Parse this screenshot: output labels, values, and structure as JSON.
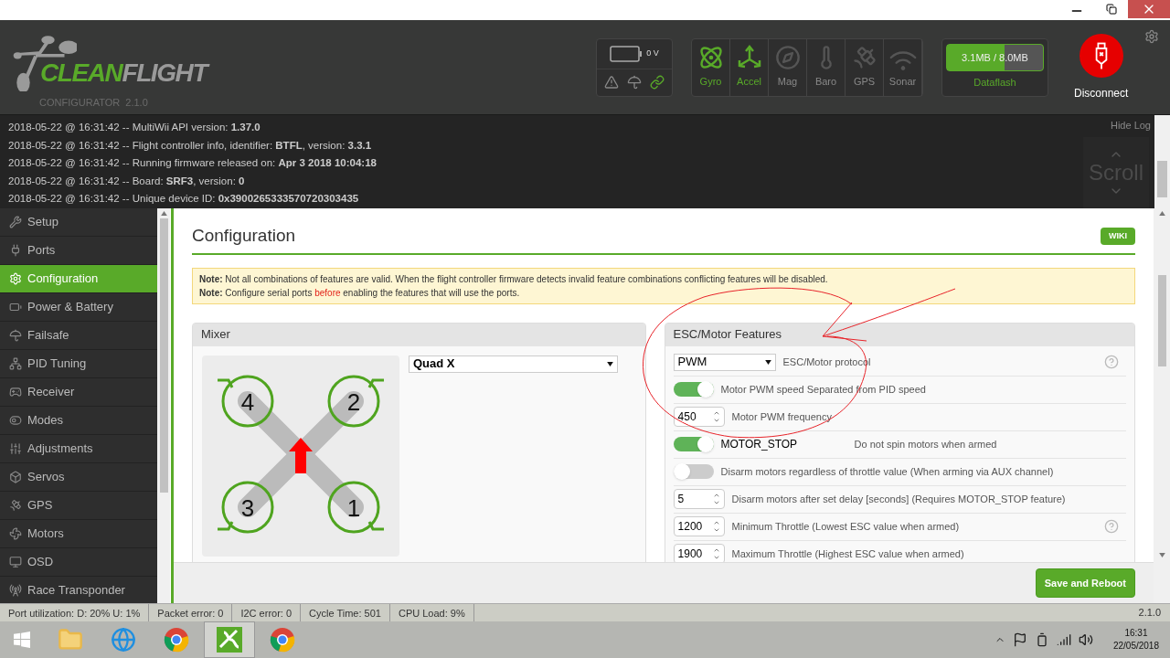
{
  "header": {
    "logo_primary": "CLEAN",
    "logo_secondary": "FLIGHT",
    "subtitle": "CONFIGURATOR  2.1.0",
    "battery": {
      "voltage": "0 V"
    },
    "sensors": [
      {
        "label": "Gyro",
        "active": true
      },
      {
        "label": "Accel",
        "active": true
      },
      {
        "label": "Mag",
        "active": false
      },
      {
        "label": "Baro",
        "active": false
      },
      {
        "label": "GPS",
        "active": false
      },
      {
        "label": "Sonar",
        "active": false
      }
    ],
    "dataflash": {
      "usage": "3.1MB / 8.0MB",
      "level": 0.6,
      "label": "Dataflash"
    },
    "disconnect": "Disconnect"
  },
  "log": {
    "lines": [
      "2018-05-22 @ 16:31:42 -- MultiWii API version: **1.37.0**",
      "2018-05-22 @ 16:31:42 -- Flight controller info, identifier: **BTFL**, version: **3.3.1**",
      "2018-05-22 @ 16:31:42 -- Running firmware released on: **Apr 3 2018 10:04:18**",
      "2018-05-22 @ 16:31:42 -- Board: **SRF3**, version: **0**",
      "2018-05-22 @ 16:31:42 -- Unique device ID: **0x3900265333570720303435**"
    ],
    "hide": "Hide Log",
    "scroll": "Scroll"
  },
  "sidebar": {
    "items": [
      {
        "label": "Setup",
        "selected": false
      },
      {
        "label": "Ports",
        "selected": false
      },
      {
        "label": "Configuration",
        "selected": true
      },
      {
        "label": "Power & Battery",
        "selected": false
      },
      {
        "label": "Failsafe",
        "selected": false
      },
      {
        "label": "PID Tuning",
        "selected": false
      },
      {
        "label": "Receiver",
        "selected": false
      },
      {
        "label": "Modes",
        "selected": false
      },
      {
        "label": "Adjustments",
        "selected": false
      },
      {
        "label": "Servos",
        "selected": false
      },
      {
        "label": "GPS",
        "selected": false
      },
      {
        "label": "Motors",
        "selected": false
      },
      {
        "label": "OSD",
        "selected": false
      },
      {
        "label": "Race Transponder",
        "selected": false
      }
    ]
  },
  "content": {
    "title": "Configuration",
    "wiki": "WIKI",
    "notes": [
      {
        "segments": [
          {
            "text": "**Note:** Not all combinations of features are valid. When the flight controller firmware detects invalid feature combinations conflicting features will be disabled.",
            "emphasis": false
          }
        ]
      },
      {
        "segments": [
          {
            "text": "**Note:** Configure serial ports ",
            "emphasis": false
          },
          {
            "text": "before",
            "emphasis": true
          },
          {
            "text": " enabling the features that will use the ports.",
            "emphasis": false
          }
        ]
      }
    ],
    "mixer": {
      "title": "Mixer",
      "type": "Quad X",
      "motors": [
        "4",
        "2",
        "3",
        "1"
      ]
    },
    "esc": {
      "title": "ESC/Motor Features",
      "rows": [
        {
          "kind": "select",
          "value": "PWM",
          "label": "ESC/Motor protocol",
          "help": true
        },
        {
          "kind": "toggle",
          "on": true,
          "label": "Motor PWM speed Separated from PID speed"
        },
        {
          "kind": "number",
          "value": "450",
          "label": "Motor PWM frequency"
        },
        {
          "kind": "feature",
          "on": true,
          "name": "MOTOR_STOP",
          "label": "Do not spin motors when armed"
        },
        {
          "kind": "toggle",
          "on": false,
          "label": "Disarm motors regardless of throttle value (When arming via AUX channel)"
        },
        {
          "kind": "number",
          "value": "5",
          "label": "Disarm motors after set delay [seconds] (Requires MOTOR_STOP feature)"
        },
        {
          "kind": "number",
          "value": "1200",
          "label": "Minimum Throttle (Lowest ESC value when armed)",
          "help": true
        },
        {
          "kind": "number",
          "value": "1900",
          "label": "Maximum Throttle (Highest ESC value when armed)"
        }
      ]
    },
    "save": "Save and Reboot"
  },
  "status_bar": {
    "items": [
      "Port utilization: D: 20% U: 1%",
      "Packet error: 0",
      "I2C error: 0",
      "Cycle Time: 501",
      "CPU Load: 9%"
    ],
    "version": "2.1.0"
  },
  "taskbar": {
    "apps": [
      {
        "active": false
      },
      {
        "active": false
      },
      {
        "active": false
      },
      {
        "active": true
      },
      {
        "active": false
      }
    ],
    "time": "16:31",
    "date": "22/05/2018"
  }
}
